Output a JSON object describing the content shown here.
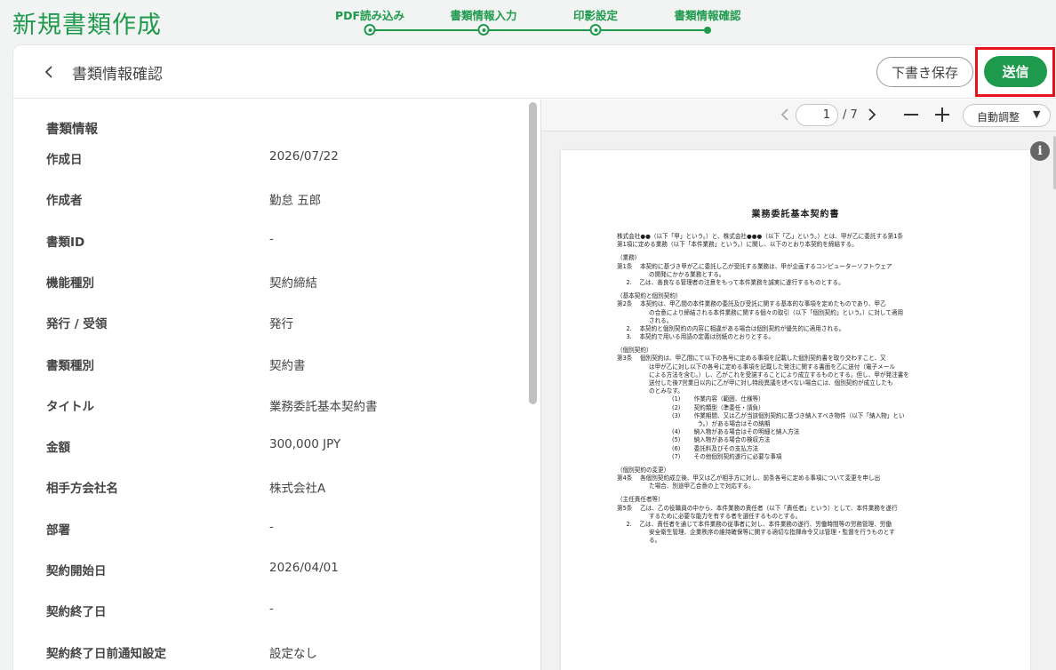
{
  "page_title": "新規書類作成",
  "stepper": {
    "steps": [
      {
        "label": "PDF読み込み"
      },
      {
        "label": "書類情報入力"
      },
      {
        "label": "印影設定"
      },
      {
        "label": "書類情報確認"
      }
    ],
    "active_step": 4
  },
  "header": {
    "title": "書類情報確認",
    "draft_label": "下書き保存",
    "send_label": "送信"
  },
  "info": {
    "section_title": "書類情報",
    "rows": [
      {
        "label": "作成日",
        "value": "2026/07/22"
      },
      {
        "label": "作成者",
        "value": "勤怠 五郎"
      },
      {
        "label": "書類ID",
        "value": "-"
      },
      {
        "label": "機能種別",
        "value": "契約締結"
      },
      {
        "label": "発行 / 受領",
        "value": "発行"
      },
      {
        "label": "書類種別",
        "value": "契約書"
      },
      {
        "label": "タイトル",
        "value": "業務委託基本契約書"
      },
      {
        "label": "金額",
        "value": "300,000 JPY"
      },
      {
        "label": "相手方会社名",
        "value": "株式会社A"
      },
      {
        "label": "部署",
        "value": "-"
      },
      {
        "label": "契約開始日",
        "value": "2026/04/01"
      },
      {
        "label": "契約終了日",
        "value": "-"
      },
      {
        "label": "契約終了日前通知設定",
        "value": "設定なし"
      }
    ]
  },
  "viewer": {
    "current_page": "1",
    "total_pages": "/ 7",
    "zoom_label": "自動調整",
    "info_icon_glyph": "i"
  },
  "document": {
    "title": "業務委託基本契約書",
    "lines": [
      {
        "t": "株式会社●●（以下「甲」という。）と、株式会社●●●（以下「乙」という。）とは、甲が乙に委託する第1条",
        "c": "ind1"
      },
      {
        "t": "第1項に定める業務（以下「本件業務」という。）に関し、以下のとおり本契約を締結する。",
        "c": "ind1"
      },
      {
        "t": "",
        "c": "gap"
      },
      {
        "t": "（業務）",
        "c": "ind1"
      },
      {
        "t": "第1条　 本契約に基づき甲が乙に委託し乙が受託する業務は、甲が企画するコンピューターソフトウェア",
        "c": "ind1"
      },
      {
        "t": "の開発にかかる業務とする。",
        "c": "ind2"
      },
      {
        "t": "     2.　 乙は、善良なる管理者の注意をもって本件業務を誠実に遂行するものとする。",
        "c": "ind1"
      },
      {
        "t": "",
        "c": "gap"
      },
      {
        "t": "（基本契約と個別契約）",
        "c": "ind1"
      },
      {
        "t": "第2条　 本契約は、甲乙間の本件業務の委託及び受託に関する基本的な事項を定めたものであり、甲乙",
        "c": "ind1"
      },
      {
        "t": "の合意により締結される本件業務に関する個々の取引（以下「個別契約」という。）に対して適用",
        "c": "ind2"
      },
      {
        "t": "される。",
        "c": "ind2"
      },
      {
        "t": "     2.　 本契約と個別契約の内容に相違がある場合は個別契約が優先的に適用される。",
        "c": "ind1"
      },
      {
        "t": "     3.　 本契約で用いる用語の定義は別紙のとおりとする。",
        "c": "ind1"
      },
      {
        "t": "",
        "c": "gap"
      },
      {
        "t": "（個別契約）",
        "c": "ind1"
      },
      {
        "t": "第3条　 個別契約は、甲乙間にて以下の各号に定める事項を記載した個別契約書を取り交わすこと、又",
        "c": "ind1"
      },
      {
        "t": "は甲が乙に対し以下の各号に定める事項を記載した発注に関する書面を乙に送付（電子メール",
        "c": "ind2"
      },
      {
        "t": "による方法を含む。）し、乙がこれを受諾することにより成立するものとする。但し、甲が発注書を",
        "c": "ind2"
      },
      {
        "t": "送付した後7営業日以内に乙が甲に対し特段異議を述べない場合には、個別契約が成立したも",
        "c": "ind2"
      },
      {
        "t": "のとみなす。",
        "c": "ind2"
      },
      {
        "t": "(1)　　 作業内容（範囲、仕様等）",
        "c": "ind3"
      },
      {
        "t": "(2)　　 契約類型（準委任・請負）",
        "c": "ind3"
      },
      {
        "t": "(3)　　 作業期間、又は乙が当該個別契約に基づき納入すべき物件（以下「納入物」とい",
        "c": "ind3"
      },
      {
        "t": "　　　　 う。）がある場合はその納期",
        "c": "ind3"
      },
      {
        "t": "(4)　　 納入物がある場合はその明細と納入方法",
        "c": "ind3"
      },
      {
        "t": "(5)　　 納入物がある場合の検収方法",
        "c": "ind3"
      },
      {
        "t": "(6)　　 委託料及びその支払方法",
        "c": "ind3"
      },
      {
        "t": "(7)　　 その他個別契約遂行に必要な事項",
        "c": "ind3"
      },
      {
        "t": "",
        "c": "gap"
      },
      {
        "t": "（個別契約の変更）",
        "c": "ind1"
      },
      {
        "t": "第4条　 各個別契約成立後、甲又は乙が相手方に対し、前条各号に定める事項について変更を申し出",
        "c": "ind1"
      },
      {
        "t": "た場合、別途甲乙合意の上で対応する。",
        "c": "ind2"
      },
      {
        "t": "",
        "c": "gap"
      },
      {
        "t": "（主任責任者等）",
        "c": "ind1"
      },
      {
        "t": "第5条　 乙は、乙の役職員の中から、本件業務の責任者（以下「責任者」という）として、本件業務を遂行",
        "c": "ind1"
      },
      {
        "t": "するために必要な能力を有する者を選任するものとする。",
        "c": "ind2"
      },
      {
        "t": "     2.　 乙は、責任者を通じて本件業務の従事者に対し、本件業務の遂行、労働時間等の労務管理、労働",
        "c": "ind1"
      },
      {
        "t": "安全衛生管理、企業秩序の維持確保等に関する適切な指揮命令又は管理・監督を行うものとす",
        "c": "ind2"
      },
      {
        "t": "る。",
        "c": "ind2"
      }
    ]
  },
  "colors": {
    "accent": "#1e9a4c",
    "highlight": "#e8121a"
  }
}
